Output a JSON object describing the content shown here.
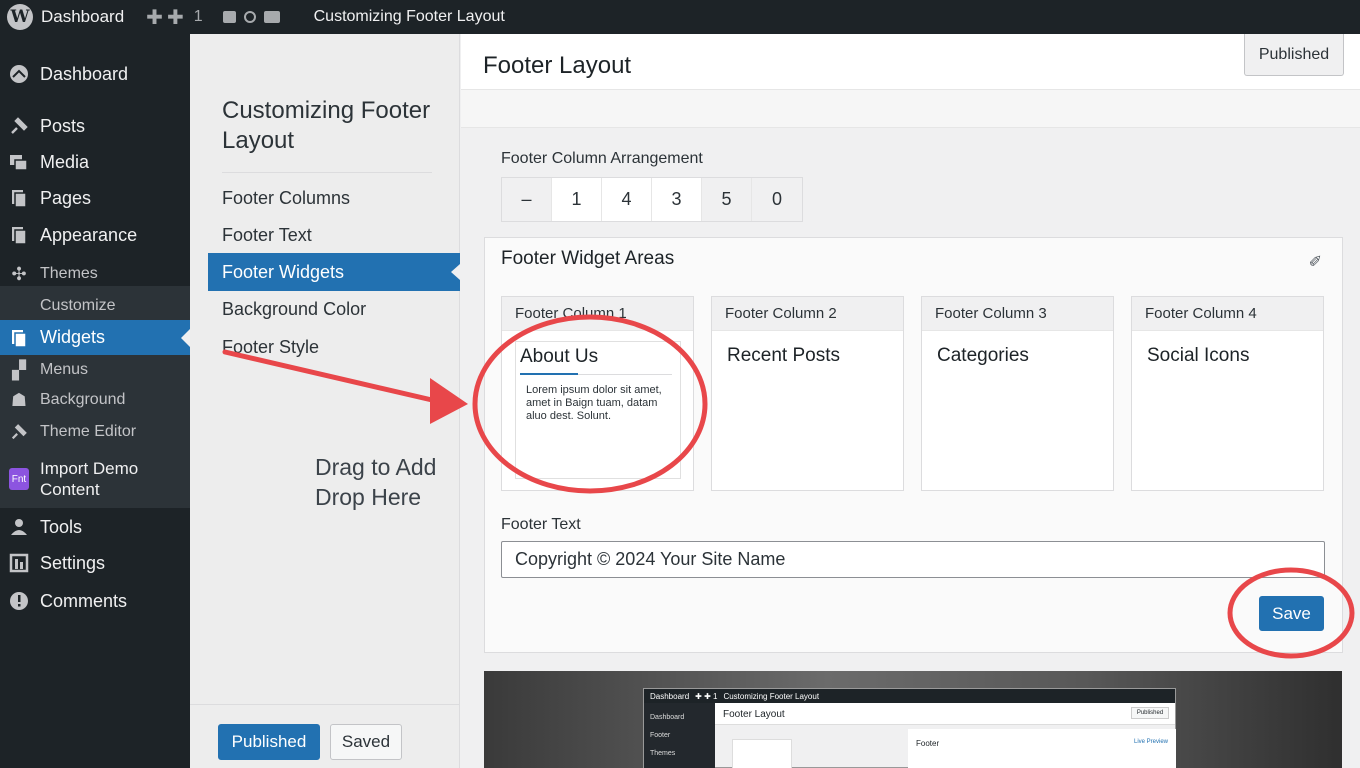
{
  "adminbar": {
    "site_label": "Dashboard",
    "new_label": "+",
    "comments_count": "1",
    "page_title": "Customizing Footer Layout"
  },
  "menu": {
    "items": [
      {
        "label": "Dashboard",
        "icon": "dashboard-icon"
      },
      {
        "label": "Posts",
        "icon": "pin-icon"
      },
      {
        "label": "Media",
        "icon": "media-icon"
      },
      {
        "label": "Pages",
        "icon": "pages-icon"
      },
      {
        "label": "Appearance",
        "icon": "appearance-icon"
      },
      {
        "label": "Themes",
        "icon": "themes-icon"
      },
      {
        "label": "Customize",
        "icon": ""
      },
      {
        "label": "Widgets",
        "icon": "widgets-icon"
      },
      {
        "label": "Menus",
        "icon": "menus-icon"
      },
      {
        "label": "Background",
        "icon": "background-icon"
      },
      {
        "label": "Theme Editor",
        "icon": "editor-icon"
      },
      {
        "label": "Import Demo Content",
        "icon": "import-plugin-icon",
        "icon_text": "Fnt"
      },
      {
        "label": "Tools",
        "icon": "tools-icon"
      },
      {
        "label": "Settings",
        "icon": "settings-icon"
      },
      {
        "label": "Comments",
        "icon": "comments-icon"
      }
    ]
  },
  "customizer": {
    "title": "Customizing Footer Layout",
    "sections": [
      "Footer Columns",
      "Footer Text",
      "Footer Widgets",
      "Background Color",
      "Footer Style"
    ],
    "active_section": "Footer Widgets",
    "drag_hint_line1": "Drag to Add",
    "drag_hint_line2": "Drop Here",
    "published_label": "Published",
    "saved_label": "Saved"
  },
  "main": {
    "title": "Footer Layout",
    "published_label": "Published",
    "arrangement_label": "Footer Column Arrangement",
    "arrangement_options": [
      "–",
      "1",
      "4",
      "3",
      "5",
      "0"
    ],
    "widget_areas_title": "Footer Widget Areas",
    "columns": [
      {
        "header": "Footer Column 1",
        "widget": "About Us",
        "text": "Lorem ipsum dolor sit amet, amet in Baign tuam, datam aluo dest. Solunt."
      },
      {
        "header": "Footer Column 2",
        "widget": "Recent Posts"
      },
      {
        "header": "Footer Column 3",
        "widget": "Categories"
      },
      {
        "header": "Footer Column 4",
        "widget": "Social Icons"
      }
    ],
    "footer_text_label": "Footer Text",
    "footer_text_value": "Copyright © 2024 Your Site Name",
    "save_label": "Save"
  },
  "preview": {
    "bar_site": "Dashboard",
    "bar_title": "Customizing Footer Layout",
    "title": "Footer Layout",
    "published": "Published",
    "side_items": [
      "Dashboard",
      "Footer",
      "Themes"
    ],
    "footer_label": "Footer",
    "live_preview": "Live Preview"
  },
  "colors": {
    "accent": "#2271b1",
    "admin_dark": "#1d2327",
    "annotation_red": "#e8474a"
  }
}
